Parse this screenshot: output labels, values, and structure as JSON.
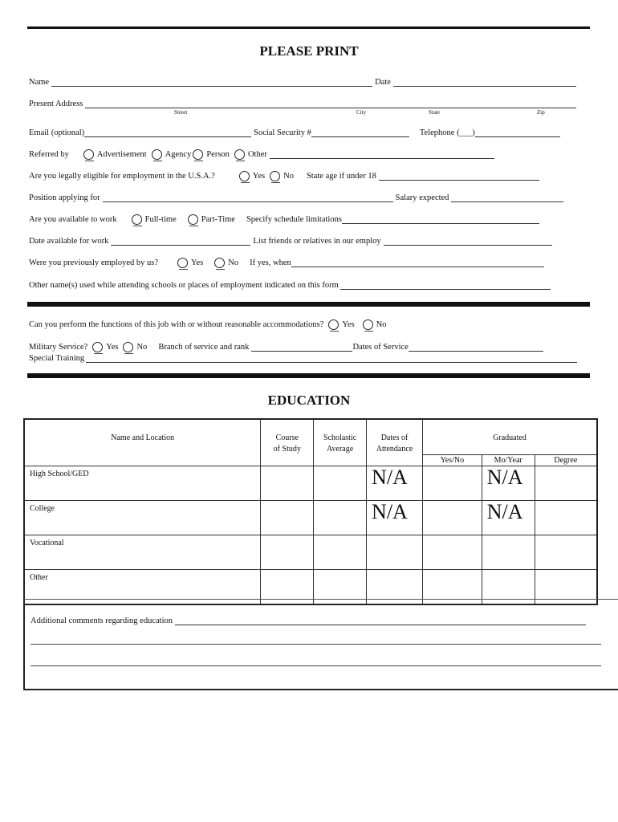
{
  "header": {
    "title": "PLEASE PRINT"
  },
  "personal": {
    "name_label": "Name",
    "date_label": "Date",
    "address_label": "Present Address",
    "address_sublabels": {
      "street": "Street",
      "city": "City",
      "state": "State",
      "zip": "Zip"
    },
    "email_label": "Email (optional)",
    "ssn_label": "Social Security #",
    "telephone_label": "Telephone (___)"
  },
  "referred": {
    "label": "Referred by",
    "options": [
      "Advertisement",
      "Agency",
      "Person",
      "Other"
    ]
  },
  "eligible": {
    "question": "Are you legally eligible for employment in the U.S.A.?",
    "yes": "Yes",
    "no": "No",
    "age_label": "State age if under 18"
  },
  "position": {
    "label": "Position applying for",
    "salary_label": "Salary expected"
  },
  "availability": {
    "label": "Are you available to work",
    "options": [
      "Full-time",
      "Part-Time"
    ],
    "limitations_label": "Specify schedule limitations"
  },
  "date_available": {
    "label": "Date available for work",
    "friends_label": "List friends or relatives in our employ"
  },
  "previous": {
    "question": "Were you previously employed by us?",
    "yes": "Yes",
    "no": "No",
    "when_label": "If yes, when"
  },
  "other_names": {
    "label": "Other  name(s) used while attending schools or places of employment indicated on this form"
  },
  "accommodations": {
    "question": "Can you perform the functions of this job with or without reasonable accommodations?",
    "yes": "Yes",
    "no": "No"
  },
  "military": {
    "label": "Military Service?",
    "yes": "Yes",
    "no": "No",
    "branch_label": "Branch of service and rank",
    "dates_label": "Dates of Service",
    "training_label": "Special Training"
  },
  "education": {
    "title": "EDUCATION",
    "columns": {
      "name": "Name and Location",
      "course_1": "Course",
      "course_2": "of Study",
      "avg_1": "Scholastic",
      "avg_2": "Average",
      "dates_1": "Dates of",
      "dates_2": "Attendance",
      "graduated": "Graduated",
      "yesno": "Yes/No",
      "moyear": "Mo/Year",
      "degree": "Degree"
    },
    "rows": [
      {
        "label": "High School/GED",
        "dates": "N/A",
        "moyear": "N/A"
      },
      {
        "label": "College",
        "dates": "N/A",
        "moyear": "N/A"
      },
      {
        "label": "Vocational",
        "dates": "",
        "moyear": ""
      },
      {
        "label": "Other",
        "dates": "",
        "moyear": ""
      }
    ],
    "comments_label": "Additional comments regarding education"
  }
}
